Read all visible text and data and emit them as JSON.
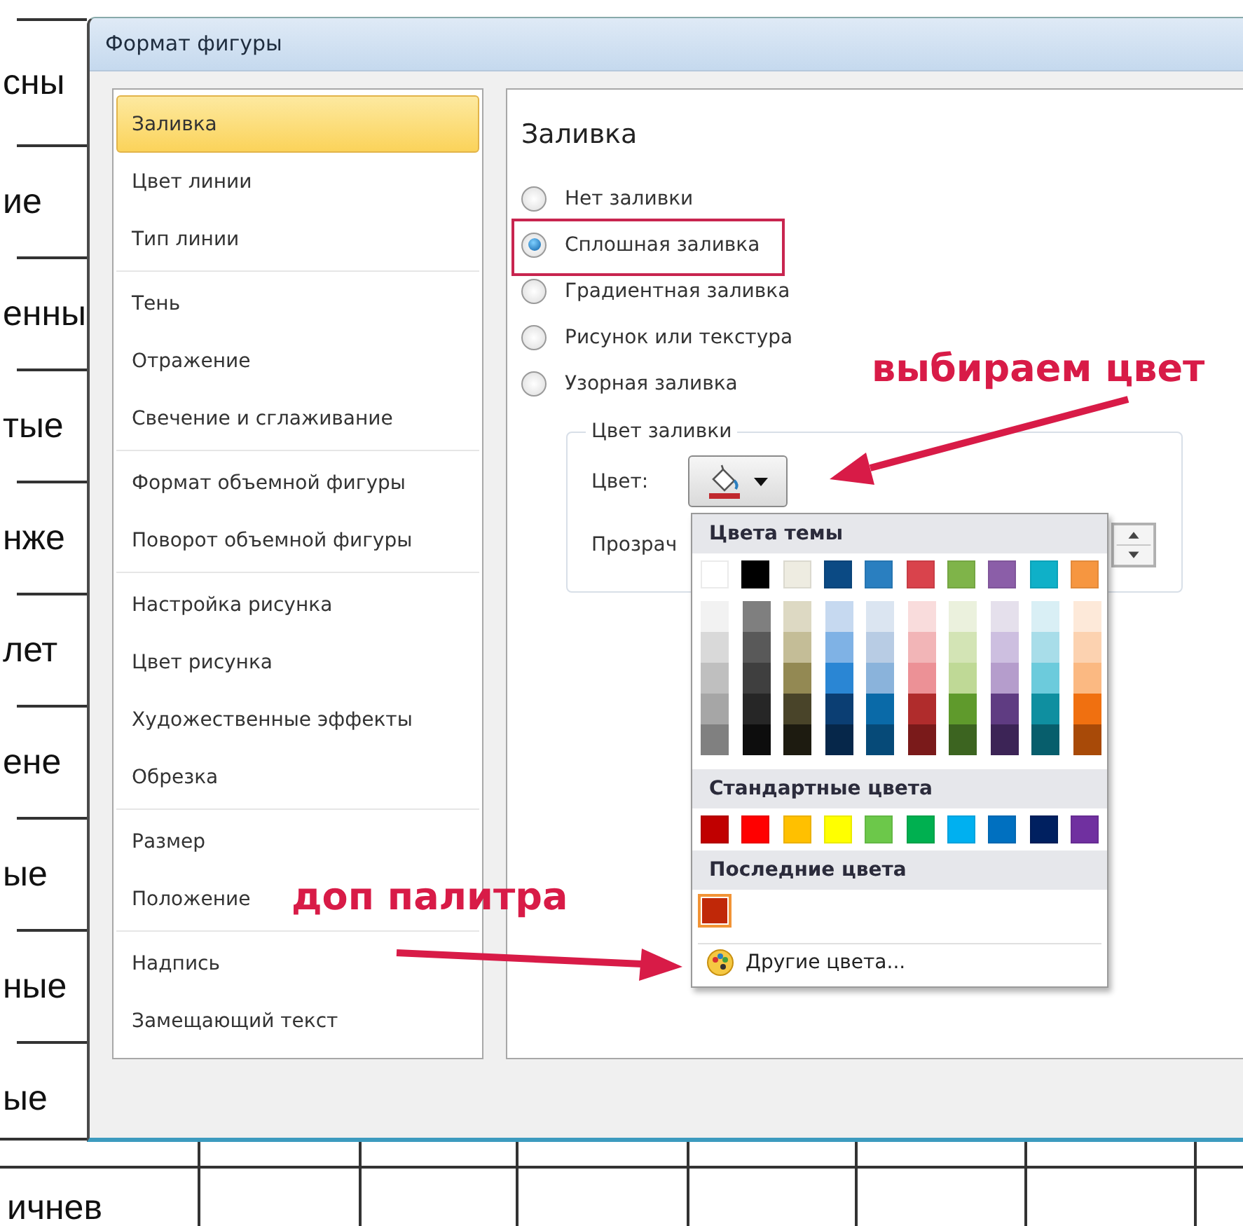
{
  "document": {
    "side_labels": [
      "сны",
      "ие",
      "енны",
      "тые",
      "нже",
      "лет",
      "ене",
      "ые",
      "ные",
      "ые"
    ],
    "bottom_label": "ичнев"
  },
  "dialog": {
    "title": "Формат фигуры",
    "nav": {
      "groups": [
        {
          "items": [
            {
              "label": "Заливка",
              "selected": true
            },
            {
              "label": "Цвет линии",
              "selected": false
            },
            {
              "label": "Тип линии",
              "selected": false
            }
          ]
        },
        {
          "items": [
            {
              "label": "Тень",
              "selected": false
            },
            {
              "label": "Отражение",
              "selected": false
            },
            {
              "label": "Свечение и сглаживание",
              "selected": false
            }
          ]
        },
        {
          "items": [
            {
              "label": "Формат объемной фигуры",
              "selected": false
            },
            {
              "label": "Поворот объемной фигуры",
              "selected": false
            }
          ]
        },
        {
          "items": [
            {
              "label": "Настройка рисунка",
              "selected": false
            },
            {
              "label": "Цвет рисунка",
              "selected": false
            },
            {
              "label": "Художественные эффекты",
              "selected": false
            },
            {
              "label": "Обрезка",
              "selected": false
            }
          ]
        },
        {
          "items": [
            {
              "label": "Размер",
              "selected": false
            },
            {
              "label": "Положение",
              "selected": false
            }
          ]
        },
        {
          "items": [
            {
              "label": "Надпись",
              "selected": false
            },
            {
              "label": "Замещающий текст",
              "selected": false
            }
          ]
        }
      ]
    },
    "fill": {
      "heading": "Заливка",
      "options": [
        {
          "label": "Нет заливки",
          "selected": false,
          "highlighted": false
        },
        {
          "label": "Сплошная заливка",
          "selected": true,
          "highlighted": true
        },
        {
          "label": "Градиентная заливка",
          "selected": false,
          "highlighted": false
        },
        {
          "label": "Рисунок или текстура",
          "selected": false,
          "highlighted": false
        },
        {
          "label": "Узорная заливка",
          "selected": false,
          "highlighted": false
        }
      ],
      "color_group": {
        "legend": "Цвет заливки",
        "color_label": "Цвет:",
        "transparency_label": "Прозрач"
      }
    },
    "color_menu": {
      "sections": [
        {
          "kind": "theme",
          "title": "Цвета темы",
          "swatches": [
            {
              "color": "#ffffff",
              "selected": false,
              "shades": [
                {
                  "color": "#f2f2f2"
                },
                {
                  "color": "#d9d9d9"
                },
                {
                  "color": "#bfbfbf"
                },
                {
                  "color": "#a6a6a6"
                },
                {
                  "color": "#808080"
                }
              ]
            },
            {
              "color": "#000000",
              "selected": false,
              "shades": [
                {
                  "color": "#7f7f7f"
                },
                {
                  "color": "#595959"
                },
                {
                  "color": "#3f3f3f"
                },
                {
                  "color": "#262626"
                },
                {
                  "color": "#0d0d0d"
                }
              ]
            },
            {
              "color": "#eeece1",
              "selected": false,
              "shades": [
                {
                  "color": "#ddd9c3"
                },
                {
                  "color": "#c4bd97"
                },
                {
                  "color": "#938953"
                },
                {
                  "color": "#494429"
                },
                {
                  "color": "#1d1b10"
                }
              ]
            },
            {
              "color": "#0b4a84",
              "selected": false,
              "shades": [
                {
                  "color": "#c6d9f0"
                },
                {
                  "color": "#7fb2e5"
                },
                {
                  "color": "#2a86d4"
                },
                {
                  "color": "#0b3e73"
                },
                {
                  "color": "#06274a"
                }
              ]
            },
            {
              "color": "#2a7fc0",
              "selected": false,
              "shades": [
                {
                  "color": "#dbe5f1"
                },
                {
                  "color": "#b8cce4"
                },
                {
                  "color": "#8ab3db"
                },
                {
                  "color": "#0a6aa8"
                },
                {
                  "color": "#064a78"
                }
              ]
            },
            {
              "color": "#d9434c",
              "selected": false,
              "shades": [
                {
                  "color": "#f9dcdc"
                },
                {
                  "color": "#f2b5b7"
                },
                {
                  "color": "#ec9196"
                },
                {
                  "color": "#b02c2c"
                },
                {
                  "color": "#7a1a1a"
                }
              ]
            },
            {
              "color": "#7fb449",
              "selected": false,
              "shades": [
                {
                  "color": "#ebf1dd"
                },
                {
                  "color": "#d3e4b5"
                },
                {
                  "color": "#bfd996"
                },
                {
                  "color": "#5f9a2c"
                },
                {
                  "color": "#3c6420"
                }
              ]
            },
            {
              "color": "#8b5ea8",
              "selected": false,
              "shades": [
                {
                  "color": "#e5e0ec"
                },
                {
                  "color": "#cdbfe0"
                },
                {
                  "color": "#b59dcc"
                },
                {
                  "color": "#5f3c82"
                },
                {
                  "color": "#3c2456"
                }
              ]
            },
            {
              "color": "#0fb0c8",
              "selected": false,
              "shades": [
                {
                  "color": "#d9eff5"
                },
                {
                  "color": "#a8dde9"
                },
                {
                  "color": "#6ccbdc"
                },
                {
                  "color": "#0f8fa0"
                },
                {
                  "color": "#075e6c"
                }
              ]
            },
            {
              "color": "#f69640",
              "selected": false,
              "shades": [
                {
                  "color": "#fde9d9"
                },
                {
                  "color": "#fcd2b0"
                },
                {
                  "color": "#fbb982"
                },
                {
                  "color": "#f07010"
                },
                {
                  "color": "#a84a08"
                }
              ]
            }
          ]
        },
        {
          "kind": "standard",
          "title": "Стандартные цвета",
          "swatches": [
            {
              "color": "#c00000",
              "selected": false
            },
            {
              "color": "#ff0000",
              "selected": false
            },
            {
              "color": "#ffc000",
              "selected": false
            },
            {
              "color": "#ffff00",
              "selected": false
            },
            {
              "color": "#6cc84a",
              "selected": false
            },
            {
              "color": "#00b050",
              "selected": false
            },
            {
              "color": "#00b0f0",
              "selected": false
            },
            {
              "color": "#0070c0",
              "selected": false
            },
            {
              "color": "#002060",
              "selected": false
            },
            {
              "color": "#7030a0",
              "selected": false
            }
          ]
        },
        {
          "kind": "recent",
          "title": "Последние цвета",
          "swatches": [
            {
              "color": "#c02808",
              "selected": true
            }
          ]
        }
      ],
      "more_colors": "Другие цвета..."
    }
  },
  "annotations": [
    {
      "text": "выбираем цвет"
    },
    {
      "text": "доп палитра"
    }
  ]
}
